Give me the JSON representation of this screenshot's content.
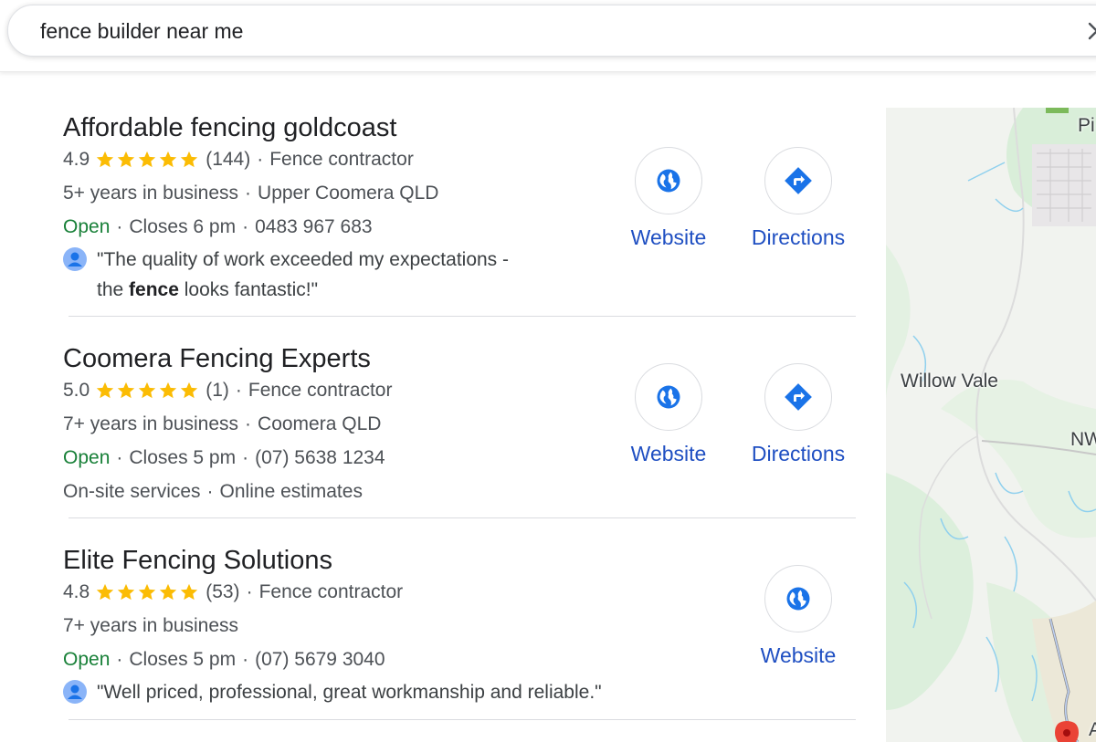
{
  "search": {
    "query": "fence builder near me"
  },
  "listings": [
    {
      "name": "Affordable fencing goldcoast",
      "rating": "4.9",
      "reviews": "(144)",
      "category": "Fence contractor",
      "years": "5+ years in business",
      "location": "Upper Coomera QLD",
      "open": "Open",
      "closes": "Closes 6 pm",
      "phone": "0483 967 683",
      "review_before": "\"The quality of work exceeded my expectations -",
      "review_line2_before": "the ",
      "review_bold": "fence",
      "review_after": " looks fantastic!\"",
      "website_label": "Website",
      "directions_label": "Directions"
    },
    {
      "name": "Coomera Fencing Experts",
      "rating": "5.0",
      "reviews": "(1)",
      "category": "Fence contractor",
      "years": "7+ years in business",
      "location": "Coomera QLD",
      "open": "Open",
      "closes": "Closes 5 pm",
      "phone": "(07) 5638 1234",
      "services": "On-site services",
      "estimates": "Online estimates",
      "website_label": "Website",
      "directions_label": "Directions"
    },
    {
      "name": "Elite Fencing Solutions",
      "rating": "4.8",
      "reviews": "(53)",
      "category": "Fence contractor",
      "years": "7+ years in business",
      "open": "Open",
      "closes": "Closes 5 pm",
      "phone": "(07) 5679 3040",
      "review": "\"Well priced, professional, great workmanship and reliable.\"",
      "website_label": "Website"
    }
  ],
  "separator": "·",
  "map": {
    "labels": {
      "willow_vale": "Willow Vale",
      "pi": "Pi",
      "nw": "NW",
      "a": "A"
    }
  },
  "colors": {
    "star": "#fbbc04",
    "open": "#188038",
    "link": "#1f4fc2",
    "icon_blue": "#1a73e8"
  }
}
